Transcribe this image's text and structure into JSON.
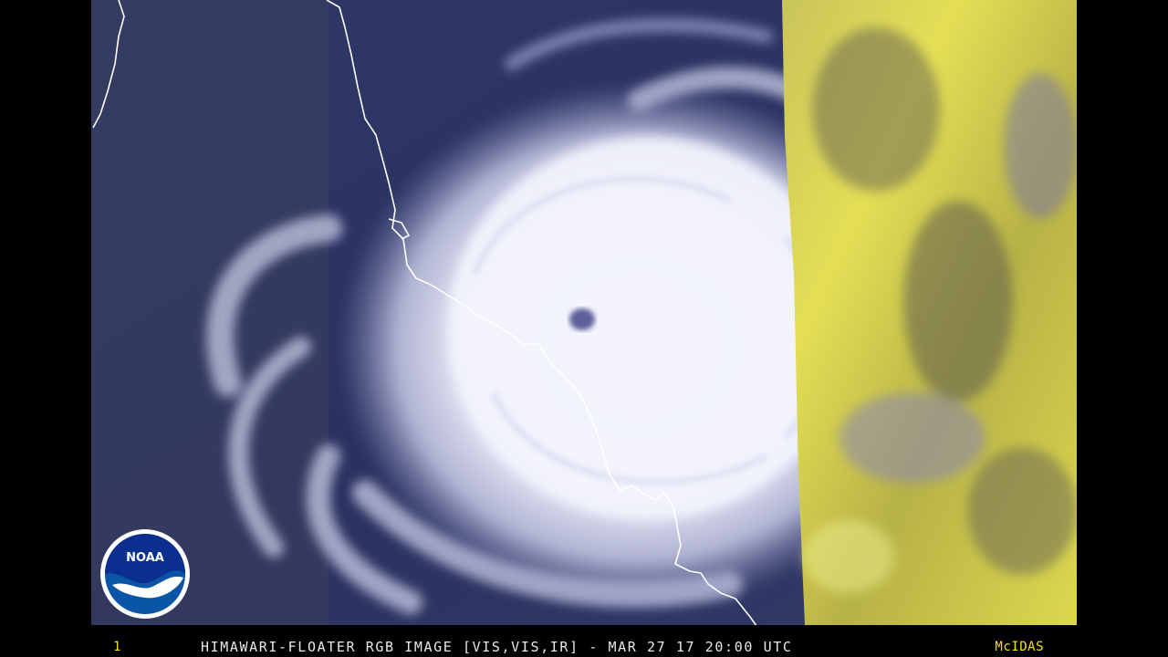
{
  "caption": {
    "frame_number": "1",
    "text": "HIMAWARI-FLOATER RGB IMAGE [VIS,VIS,IR] - MAR 27 17 20:00 UTC",
    "brand": "McIDAS"
  },
  "logo": {
    "text": "NOAA",
    "icon": "noaa-logo",
    "colors": {
      "outer": "#ffffff",
      "ring_blue": "#0b55a6",
      "top_blue": "#0a2f8e",
      "bird": "#ffffff"
    }
  },
  "colors": {
    "background": "#000000",
    "ocean": "#2a3360",
    "cloud": "#f1f2fb",
    "coastline": "#ffffff",
    "land_yellow": "#d9d44a",
    "caption_text": "#e8e8e8",
    "caption_accent": "#f2e000"
  }
}
